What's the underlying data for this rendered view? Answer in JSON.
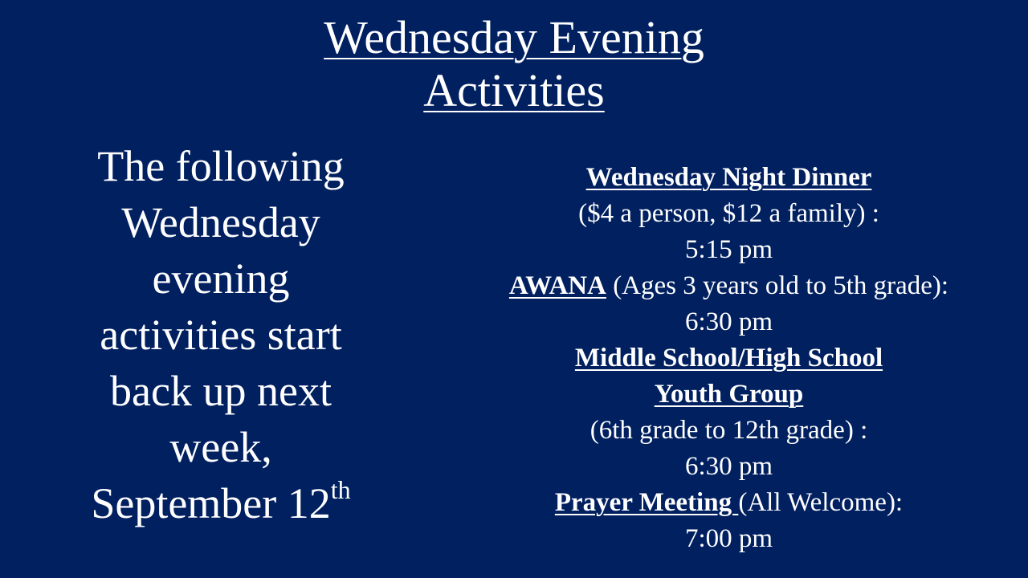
{
  "slide": {
    "background_color": "#012060",
    "text_color": "#ffffff",
    "title": {
      "line1": "Wednesday Evening",
      "line2": "Activities"
    },
    "announcement": {
      "lines": [
        "The following",
        "Wednesday",
        "evening",
        "activities start",
        "back up next",
        "week,"
      ],
      "date_text": "September 12",
      "date_suffix": "th"
    },
    "schedule": {
      "dinner": {
        "name": "Wednesday Night Dinner",
        "details": "($4 a person, $12 a family) :",
        "time": "5:15 pm"
      },
      "awana": {
        "name": "AWANA",
        "details": " (Ages 3 years old to 5th grade):",
        "time": "6:30 pm"
      },
      "youth": {
        "name_line1": "Middle School/High School",
        "name_line2": "Youth Group",
        "details": "(6th grade to 12th grade) :",
        "time": "6:30 pm"
      },
      "prayer": {
        "name": "Prayer Meeting ",
        "details": "(All Welcome):",
        "time": "7:00 pm"
      }
    }
  }
}
